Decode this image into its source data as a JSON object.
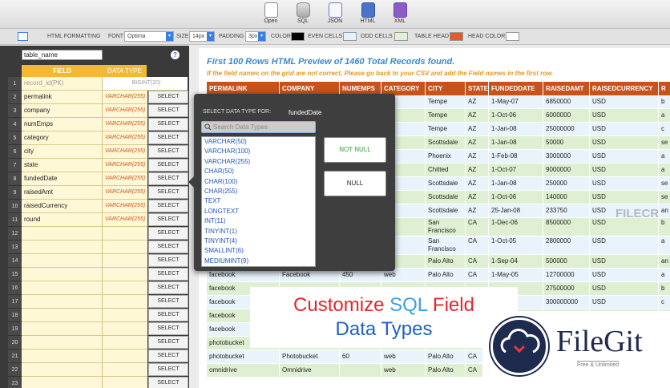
{
  "toolbar": {
    "buttons": [
      {
        "name": "open",
        "label": "Open"
      },
      {
        "name": "sql",
        "label": "SQL"
      },
      {
        "name": "json",
        "label": "JSON"
      },
      {
        "name": "html",
        "label": "HTML"
      },
      {
        "name": "xml",
        "label": "XML"
      }
    ]
  },
  "formatting": {
    "title": "HTML FORMATTING",
    "font_label": "FONT",
    "font_value": "Optima",
    "size_label": "SIZE",
    "size_value": "14px",
    "padding_label": "PADDING",
    "padding_value": "3px",
    "color_label": "COLOR",
    "even_label": "EVEN CELLS",
    "odd_label": "ODD CELLS",
    "table_head_label": "TABLE HEAD",
    "head_color_label": "HEAD COLOR",
    "colors": {
      "color": "#000000",
      "even": "#e6f1fa",
      "odd": "#e2f0d8",
      "table_head": "#e55a2b",
      "head_color": "#ffffff"
    }
  },
  "fields_panel": {
    "table_name": "table_name",
    "help": "?",
    "col_field": "FIELD",
    "col_type": "DATA TYPE",
    "select_label": "SELECT",
    "rows": [
      {
        "num": "1",
        "field": "record_id(PK)",
        "type": "BIGINT(20)"
      },
      {
        "num": "2",
        "field": "permalink",
        "type": "VARCHAR(255)"
      },
      {
        "num": "3",
        "field": "company",
        "type": "VARCHAR(255)"
      },
      {
        "num": "4",
        "field": "numEmps",
        "type": "VARCHAR(255)"
      },
      {
        "num": "5",
        "field": "category",
        "type": "VARCHAR(255)"
      },
      {
        "num": "6",
        "field": "city",
        "type": "VARCHAR(255)"
      },
      {
        "num": "7",
        "field": "state",
        "type": "VARCHAR(255)"
      },
      {
        "num": "8",
        "field": "fundedDate",
        "type": "VARCHAR(255)"
      },
      {
        "num": "9",
        "field": "raisedAmt",
        "type": "VARCHAR(255)"
      },
      {
        "num": "10",
        "field": "raisedCurrency",
        "type": "VARCHAR(255)"
      },
      {
        "num": "11",
        "field": "round",
        "type": "VARCHAR(255)"
      },
      {
        "num": "12",
        "field": "",
        "type": ""
      },
      {
        "num": "13",
        "field": "",
        "type": ""
      },
      {
        "num": "14",
        "field": "",
        "type": ""
      },
      {
        "num": "15",
        "field": "",
        "type": ""
      },
      {
        "num": "16",
        "field": "",
        "type": ""
      },
      {
        "num": "17",
        "field": "",
        "type": ""
      },
      {
        "num": "18",
        "field": "",
        "type": ""
      },
      {
        "num": "19",
        "field": "",
        "type": ""
      },
      {
        "num": "20",
        "field": "",
        "type": ""
      },
      {
        "num": "21",
        "field": "",
        "type": ""
      },
      {
        "num": "22",
        "field": "",
        "type": ""
      },
      {
        "num": "23",
        "field": "",
        "type": ""
      }
    ]
  },
  "preview": {
    "title": "First 100 Rows HTML Preview of 1460 Total Records found.",
    "subtitle": "If the field names on the grid are not correct, Please go back to your CSV and add the Field names in the first row.",
    "columns": [
      "PERMALINK",
      "COMPANY",
      "NUMEMPS",
      "CATEGORY",
      "CITY",
      "STATE",
      "FUNDEDDATE",
      "RAISEDAMT",
      "RAISEDCURRENCY",
      "R"
    ],
    "rows": [
      [
        "",
        "",
        "",
        "",
        "Tempe",
        "AZ",
        "1-May-07",
        "6850000",
        "USD",
        "b"
      ],
      [
        "",
        "",
        "",
        "",
        "Tempe",
        "AZ",
        "1-Oct-06",
        "6000000",
        "USD",
        "a"
      ],
      [
        "",
        "",
        "",
        "",
        "Tempe",
        "AZ",
        "1-Jan-08",
        "25000000",
        "USD",
        "c"
      ],
      [
        "",
        "",
        "",
        "",
        "Scottsdale",
        "AZ",
        "1-Jan-08",
        "50000",
        "USD",
        "se"
      ],
      [
        "",
        "",
        "",
        "",
        "Phoenix",
        "AZ",
        "1-Feb-08",
        "3000000",
        "USD",
        "a"
      ],
      [
        "",
        "",
        "",
        "are",
        "Chitted",
        "AZ",
        "1-Oct-07",
        "9000000",
        "USD",
        "a"
      ],
      [
        "",
        "",
        "",
        "",
        "Scottsdale",
        "AZ",
        "1-Jan-08",
        "250000",
        "USD",
        "se"
      ],
      [
        "",
        "",
        "",
        "",
        "Scottsdale",
        "AZ",
        "1-Oct-06",
        "140000",
        "USD",
        "se"
      ],
      [
        "",
        "",
        "",
        "",
        "Scottsdale",
        "AZ",
        "25-Jan-08",
        "233750",
        "USD",
        "an"
      ],
      [
        "",
        "",
        "",
        "",
        "San Francisco",
        "CA",
        "1-Dec-06",
        "8500000",
        "USD",
        "b"
      ],
      [
        "",
        "",
        "",
        "",
        "San Francisco",
        "CA",
        "1-Oct-05",
        "2800000",
        "USD",
        "a"
      ],
      [
        "",
        "",
        "",
        "",
        "Palo Alto",
        "CA",
        "1-Sep-04",
        "500000",
        "USD",
        "an"
      ],
      [
        "facebook",
        "Facebook",
        "450",
        "web",
        "Palo Alto",
        "CA",
        "1-May-05",
        "12700000",
        "USD",
        "a"
      ],
      [
        "facebook",
        "",
        "",
        "",
        "",
        "",
        "",
        "27500000",
        "USD",
        "b"
      ],
      [
        "facebook",
        "",
        "",
        "",
        "",
        "",
        "",
        "300000000",
        "USD",
        "c"
      ],
      [
        "facebook",
        "",
        "",
        "",
        "",
        "",
        "",
        "",
        "",
        ""
      ],
      [
        "facebook",
        "",
        "",
        "",
        "",
        "",
        "",
        "",
        "",
        ""
      ],
      [
        "photobucket",
        "Photobucket",
        "60",
        "web",
        "Palo Alto",
        "CA",
        "",
        "",
        "",
        ""
      ],
      [
        "photobucket",
        "Photobucket",
        "60",
        "web",
        "Palo Alto",
        "CA",
        "",
        "",
        "",
        ""
      ],
      [
        "omnidrive",
        "Omnidrive",
        "",
        "web",
        "Palo Alto",
        "CA",
        "1-Dec-06",
        "",
        "",
        ""
      ]
    ]
  },
  "popover": {
    "label": "SELECT DATA TYPE FOR:",
    "field": "fundedDate",
    "search_placeholder": "Search Data Types",
    "types": [
      "VARCHAR(50)",
      "VARCHAR(100)",
      "VARCHAR(255)",
      "CHAR(50)",
      "CHAR(100)",
      "CHAR(255)",
      "TEXT",
      "LONGTEXT",
      "INT(11)",
      "TINYINT(1)",
      "TINYINT(4)",
      "SMALLINT(6)",
      "MEDIUMINT(9)"
    ],
    "not_null": "NOT NULL",
    "null": "NULL"
  },
  "banner": {
    "word1": "Customize",
    "word2": "SQL",
    "word3": "Field",
    "line2": "Data Types"
  },
  "filegit": {
    "name": "FileGit",
    "tagline": "Free & Unlimited"
  },
  "watermark": "FILECR"
}
